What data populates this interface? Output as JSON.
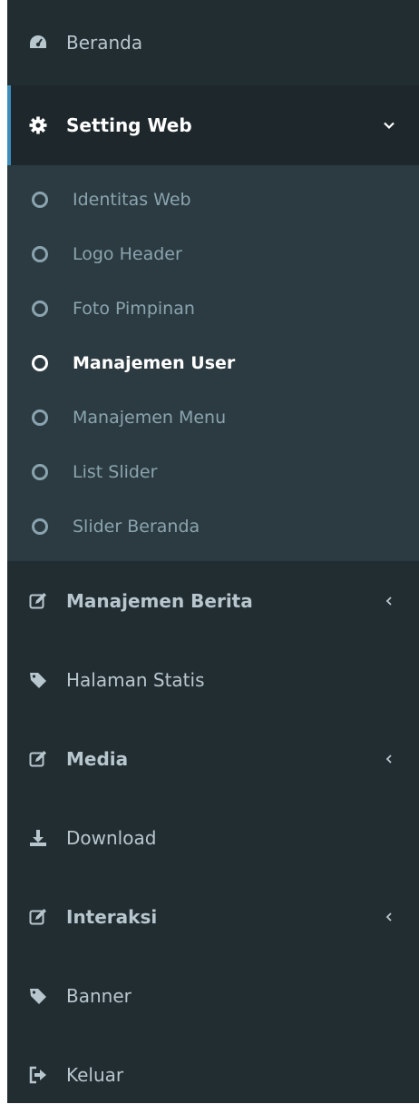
{
  "colors": {
    "sidebar_bg": "#222d32",
    "active_bg": "#1e282c",
    "submenu_bg": "#2c3b41",
    "accent": "#3c8dbc",
    "text": "#b8c7ce",
    "subtext": "#8aa4af",
    "active_text": "#ffffff"
  },
  "menu": {
    "beranda": {
      "label": "Beranda",
      "icon": "dashboard-icon"
    },
    "setting_web": {
      "label": "Setting Web",
      "icon": "gear-icon",
      "expanded": true,
      "children": [
        {
          "label": "Identitas Web",
          "icon": "circle-outline-icon"
        },
        {
          "label": "Logo Header",
          "icon": "circle-outline-icon"
        },
        {
          "label": "Foto Pimpinan",
          "icon": "circle-outline-icon"
        },
        {
          "label": "Manajemen User",
          "icon": "circle-outline-icon",
          "current": true
        },
        {
          "label": "Manajemen Menu",
          "icon": "circle-outline-icon"
        },
        {
          "label": "List Slider",
          "icon": "circle-outline-icon"
        },
        {
          "label": "Slider Beranda",
          "icon": "circle-outline-icon"
        }
      ]
    },
    "manajemen_berita": {
      "label": "Manajemen Berita",
      "icon": "edit-icon"
    },
    "halaman_statis": {
      "label": "Halaman Statis",
      "icon": "tag-icon"
    },
    "media": {
      "label": "Media",
      "icon": "edit-icon"
    },
    "download": {
      "label": "Download",
      "icon": "download-icon"
    },
    "interaksi": {
      "label": "Interaksi",
      "icon": "edit-icon"
    },
    "banner": {
      "label": "Banner",
      "icon": "tag-icon"
    },
    "keluar": {
      "label": "Keluar",
      "icon": "sign-out-icon"
    }
  }
}
